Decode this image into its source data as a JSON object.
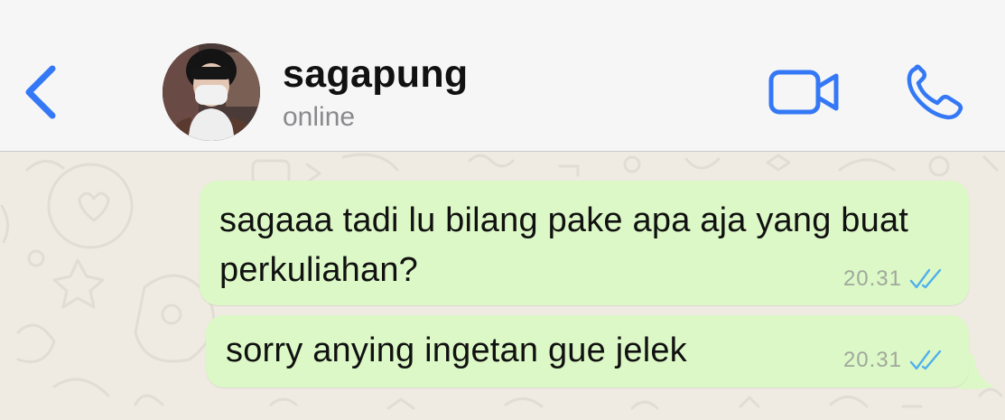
{
  "header": {
    "back_icon": "chevron-left-icon",
    "contact_name": "sagapung",
    "status": "online",
    "video_icon": "video-camera-icon",
    "call_icon": "phone-icon"
  },
  "messages": [
    {
      "text": "sagaaa tadi lu bilang pake apa aja yang buat perkuliahan?",
      "time": "20.31",
      "receipt": "read"
    },
    {
      "text": "sorry anying ingetan gue jelek",
      "time": "20.31",
      "receipt": "read"
    }
  ],
  "colors": {
    "accent": "#3478f6",
    "bubble_outgoing": "#dcf8c6",
    "read_ticks": "#4fb0ec",
    "wallpaper": "#efeae2",
    "header_bg": "#f6f6f6"
  }
}
